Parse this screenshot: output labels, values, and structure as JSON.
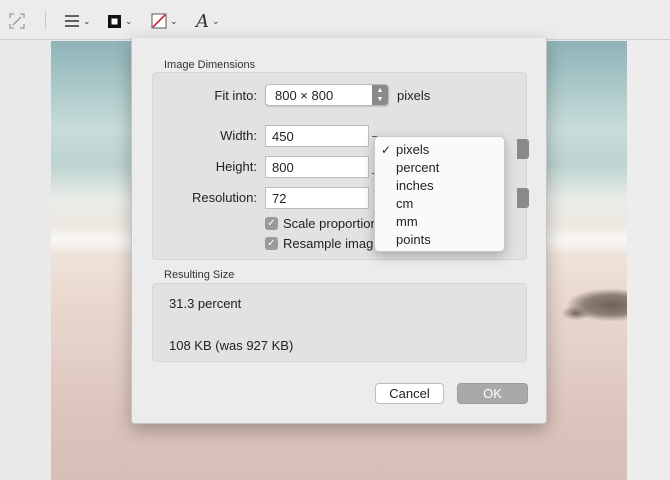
{
  "toolbar": {
    "items": [
      {
        "name": "crop-icon"
      },
      {
        "name": "line-style-icon"
      },
      {
        "name": "border-color-icon"
      },
      {
        "name": "fill-color-icon"
      },
      {
        "name": "text-style-icon",
        "glyph": "A"
      }
    ]
  },
  "dialog": {
    "image_dimensions": {
      "title": "Image Dimensions",
      "fit_into_label": "Fit into:",
      "fit_into_value": "800 × 800",
      "fit_into_unit": "pixels",
      "width_label": "Width:",
      "width_value": "450",
      "height_label": "Height:",
      "height_value": "800",
      "resolution_label": "Resolution:",
      "resolution_value": "72",
      "scale_label": "Scale proportionall",
      "scale_checked": true,
      "resample_label": "Resample image",
      "resample_checked": true
    },
    "resulting_size": {
      "title": "Resulting Size",
      "percent": "31.3 percent",
      "size": "108 KB (was 927 KB)"
    },
    "buttons": {
      "cancel": "Cancel",
      "ok": "OK"
    }
  },
  "units_menu": {
    "selected": "pixels",
    "options": [
      "pixels",
      "percent",
      "inches",
      "cm",
      "mm",
      "points"
    ]
  },
  "colors": {
    "ok_button": "#a9a9ab",
    "checkbox": "#9a9a9a"
  }
}
